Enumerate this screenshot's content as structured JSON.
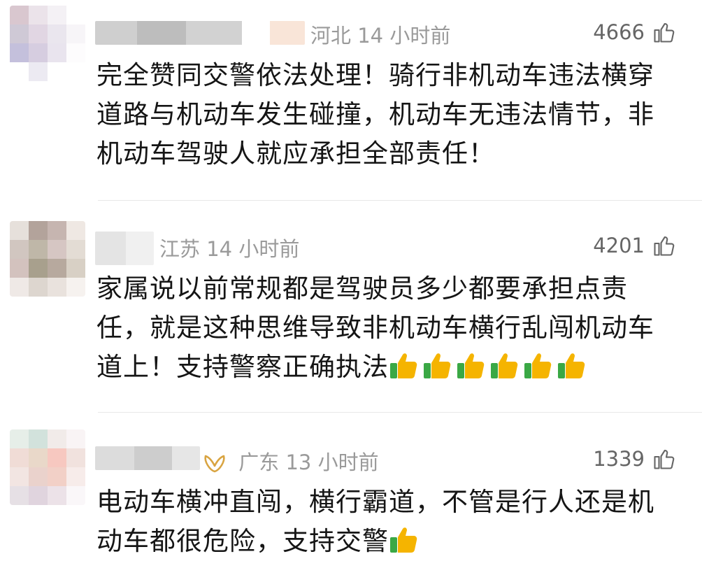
{
  "comments": [
    {
      "location": "河北",
      "time": "14 小时前",
      "likes": "4666",
      "text": "完全赞同交警依法处理！骑行非机动车违法横穿道路与机动车发生碰撞，机动车无违法情节，非机动车驾驶人就应承担全部责任！",
      "emoji_count": 0
    },
    {
      "location": "江苏",
      "time": "14 小时前",
      "likes": "4201",
      "text": "家属说以前常规都是驾驶员多少都要承担点责任，就是这种思维导致非机动车横行乱闯机动车道上！支持警察正确执法",
      "emoji_count": 6
    },
    {
      "location": "广东",
      "time": "13 小时前",
      "likes": "1339",
      "text": "电动车横冲直闯，横行霸道，不管是行人还是机动车都很危险，支持交警",
      "emoji_count": 1,
      "vip_badge": true
    }
  ],
  "icons": {
    "like": "thumbs-up-outline-icon",
    "emoji": "thumbs-up-emoji-icon",
    "badge": "gold-vip-badge-icon"
  },
  "colors": {
    "meta": "#9a9a9a",
    "text": "#151515",
    "emoji_yellow": "#f5b400",
    "emoji_green": "#3aa845",
    "badge_gold": "#d9a441"
  }
}
